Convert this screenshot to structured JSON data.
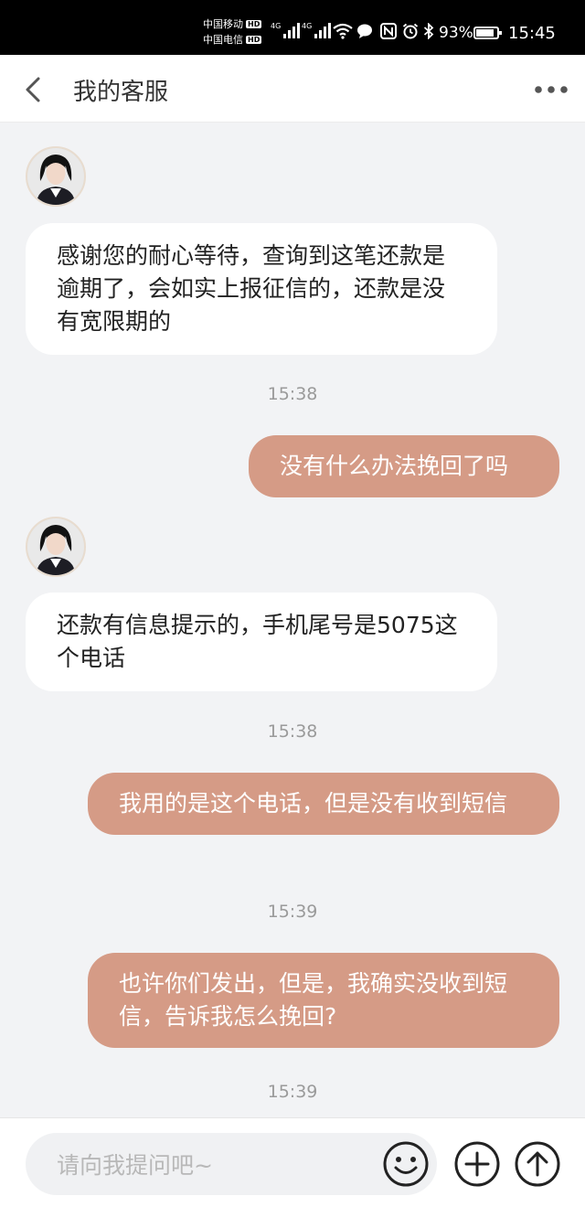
{
  "status_bar": {
    "carrier_1": "中国移动",
    "carrier_2": "中国电信",
    "hd_label": "HD",
    "network_1": "4G",
    "network_2": "4G",
    "battery_percent": "93%",
    "battery_level": 0.93,
    "time": "15:45"
  },
  "header": {
    "title": "我的客服",
    "back_icon": "chevron-left-icon",
    "more_icon": "more-dots-icon"
  },
  "messages": [
    {
      "from": "agent",
      "text": "感谢您的耐心等待，查询到这笔还款是逾期了，会如实上报征信的，还款是没有宽限期的"
    },
    {
      "timestamp": "15:38"
    },
    {
      "from": "user",
      "text": "没有什么办法挽回了吗"
    },
    {
      "from": "agent",
      "text": "还款有信息提示的，手机尾号是5075这个电话"
    },
    {
      "timestamp": "15:38"
    },
    {
      "from": "user",
      "text": "我用的是这个电话，但是没有收到短信"
    },
    {
      "timestamp": "15:39"
    },
    {
      "from": "user",
      "text": "也许你们发出，但是，我确实没收到短信，告诉我怎么挽回?"
    },
    {
      "timestamp": "15:39"
    }
  ],
  "input": {
    "placeholder": "请向我提问吧~",
    "value": ""
  },
  "colors": {
    "user_bubble": "#d59b86",
    "agent_bubble": "#ffffff",
    "chat_background": "#f2f3f5"
  }
}
